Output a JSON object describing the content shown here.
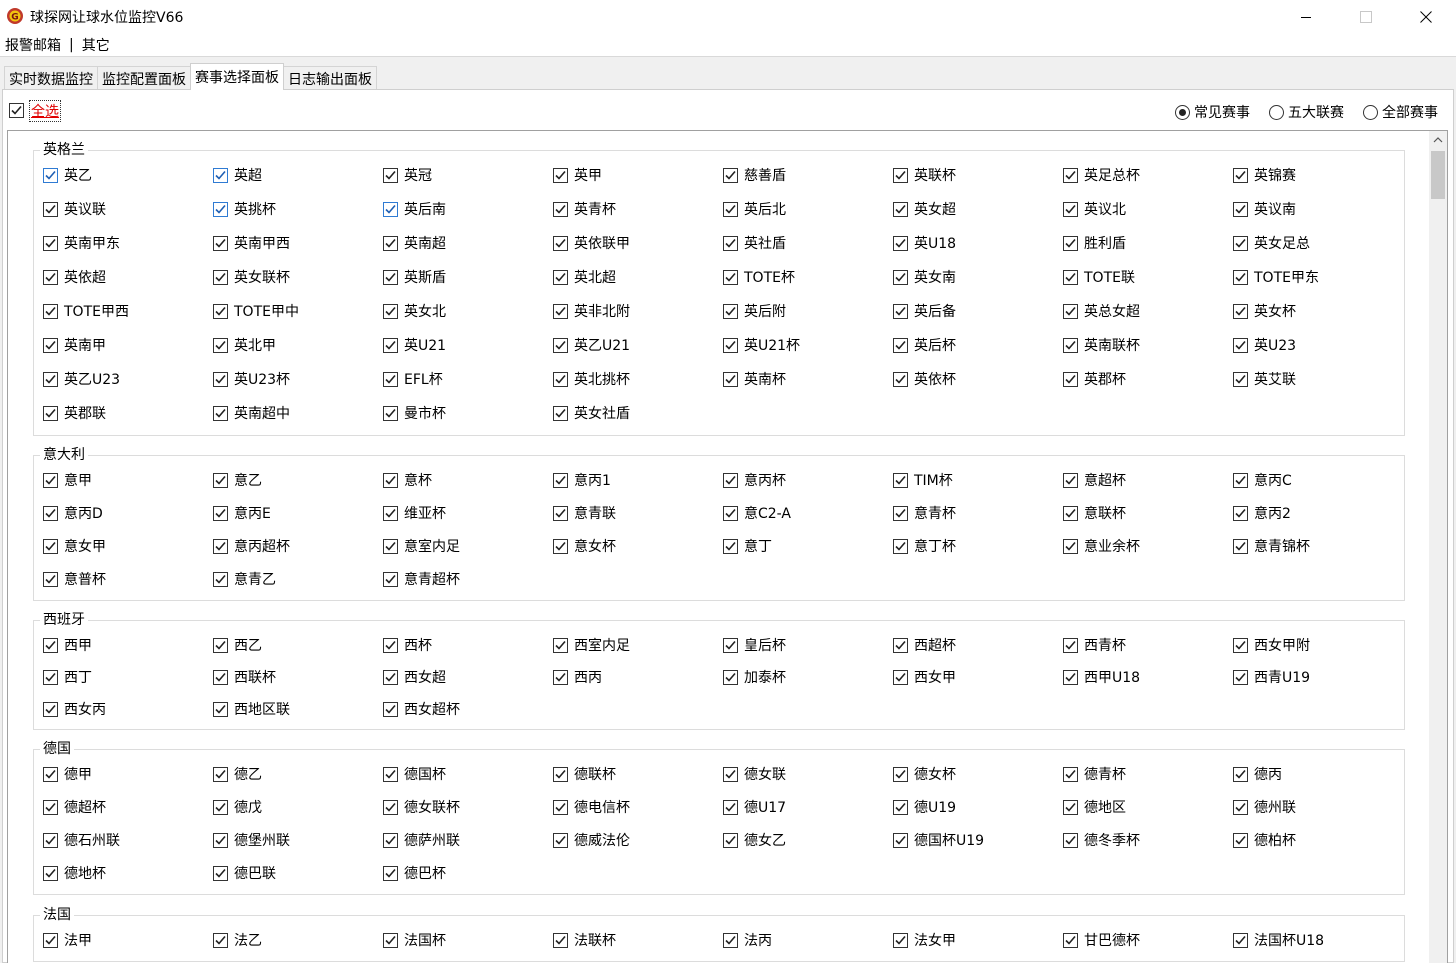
{
  "window": {
    "title": "球探网让球水位监控V66"
  },
  "menu": {
    "items": [
      "报警邮箱",
      "其它"
    ],
    "separator": "|"
  },
  "tabs": [
    "实时数据监控",
    "监控配置面板",
    "赛事选择面板",
    "日志输出面板"
  ],
  "active_tab": 2,
  "toolbar": {
    "select_all_label": "全选",
    "select_all_checked": true,
    "radios": [
      {
        "label": "常见赛事",
        "selected": true
      },
      {
        "label": "五大联赛",
        "selected": false
      },
      {
        "label": "全部赛事",
        "selected": false
      }
    ]
  },
  "groups": [
    {
      "title": "英格兰",
      "items": [
        "英乙",
        "英超",
        "英冠",
        "英甲",
        "慈善盾",
        "英联杯",
        "英足总杯",
        "英锦赛",
        "英议联",
        "英挑杯",
        "英后南",
        "英青杯",
        "英后北",
        "英女超",
        "英议北",
        "英议南",
        "英南甲东",
        "英南甲西",
        "英南超",
        "英依联甲",
        "英社盾",
        "英U18",
        "胜利盾",
        "英女足总",
        "英依超",
        "英女联杯",
        "英斯盾",
        "英北超",
        "TOTE杯",
        "英女南",
        "TOTE联",
        "TOTE甲东",
        "TOTE甲西",
        "TOTE甲中",
        "英女北",
        "英非北附",
        "英后附",
        "英后备",
        "英总女超",
        "英女杯",
        "英南甲",
        "英北甲",
        "英U21",
        "英乙U21",
        "英U21杯",
        "英后杯",
        "英南联杯",
        "英U23",
        "英乙U23",
        "英U23杯",
        "EFL杯",
        "英北挑杯",
        "英南杯",
        "英依杯",
        "英郡杯",
        "英艾联",
        "英郡联",
        "英南超中",
        "曼市杯",
        "英女社盾"
      ],
      "blue_items": [
        0,
        1,
        9,
        10
      ]
    },
    {
      "title": "意大利",
      "items": [
        "意甲",
        "意乙",
        "意杯",
        "意丙1",
        "意丙杯",
        "TIM杯",
        "意超杯",
        "意丙C",
        "意丙D",
        "意丙E",
        "维亚杯",
        "意青联",
        "意C2-A",
        "意青杯",
        "意联杯",
        "意丙2",
        "意女甲",
        "意丙超杯",
        "意室内足",
        "意女杯",
        "意丁",
        "意丁杯",
        "意业余杯",
        "意青锦杯",
        "意普杯",
        "意青乙",
        "意青超杯"
      ],
      "blue_items": []
    },
    {
      "title": "西班牙",
      "items": [
        "西甲",
        "西乙",
        "西杯",
        "西室内足",
        "皇后杯",
        "西超杯",
        "西青杯",
        "西女甲附",
        "西丁",
        "西联杯",
        "西女超",
        "西丙",
        "加泰杯",
        "西女甲",
        "西甲U18",
        "西青U19",
        "西女丙",
        "西地区联",
        "西女超杯"
      ],
      "blue_items": []
    },
    {
      "title": "德国",
      "items": [
        "德甲",
        "德乙",
        "德国杯",
        "德联杯",
        "德女联",
        "德女杯",
        "德青杯",
        "德丙",
        "德超杯",
        "德戊",
        "德女联杯",
        "德电信杯",
        "德U17",
        "德U19",
        "德地区",
        "德州联",
        "德石州联",
        "德堡州联",
        "德萨州联",
        "德威法伦",
        "德女乙",
        "德国杯U19",
        "德冬季杯",
        "德柏杯",
        "德地杯",
        "德巴联",
        "德巴杯"
      ],
      "blue_items": []
    },
    {
      "title": "法国",
      "items": [
        "法甲",
        "法乙",
        "法国杯",
        "法联杯",
        "法丙",
        "法女甲",
        "甘巴德杯",
        "法国杯U18"
      ],
      "blue_items": []
    }
  ]
}
